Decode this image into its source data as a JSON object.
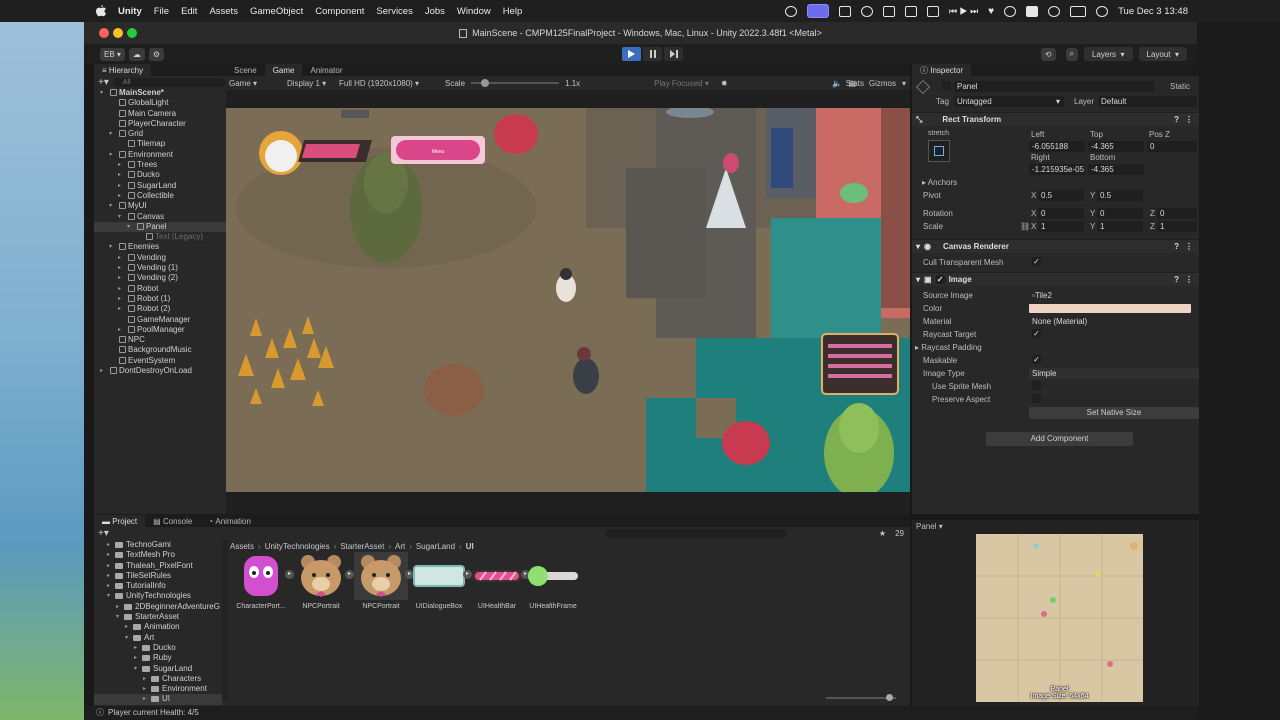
{
  "menubar": {
    "app": "Unity",
    "items": [
      "File",
      "Edit",
      "Assets",
      "GameObject",
      "Component",
      "Services",
      "Jobs",
      "Window",
      "Help"
    ],
    "clock": "Tue Dec 3  13:48"
  },
  "window": {
    "title": "MainScene - CMPM125FinalProject - Windows, Mac, Linux - Unity 2022.3.48f1 <Metal>"
  },
  "toolbar": {
    "account": "EB",
    "layers": "Layers",
    "layout": "Layout"
  },
  "hierarchy": {
    "tab": "Hierarchy",
    "search_placeholder": "All",
    "rows": [
      {
        "label": "MainScene*",
        "depth": 0,
        "arrow": "▾",
        "bold": true
      },
      {
        "label": "GlobalLight",
        "depth": 1
      },
      {
        "label": "Main Camera",
        "depth": 1
      },
      {
        "label": "PlayerCharacter",
        "depth": 1
      },
      {
        "label": "Grid",
        "depth": 1,
        "arrow": "▾"
      },
      {
        "label": "Tilemap",
        "depth": 2
      },
      {
        "label": "Environment",
        "depth": 1,
        "arrow": "▾"
      },
      {
        "label": "Trees",
        "depth": 2,
        "arrow": "▸"
      },
      {
        "label": "Ducko",
        "depth": 2,
        "arrow": "▸"
      },
      {
        "label": "SugarLand",
        "depth": 2,
        "arrow": "▸"
      },
      {
        "label": "Collectible",
        "depth": 2,
        "arrow": "▸"
      },
      {
        "label": "MyUI",
        "depth": 1,
        "arrow": "▾"
      },
      {
        "label": "Canvas",
        "depth": 2,
        "arrow": "▾"
      },
      {
        "label": "Panel",
        "depth": 3,
        "arrow": "▾",
        "sel": true
      },
      {
        "label": "Text (Legacy)",
        "depth": 4,
        "dim": true
      },
      {
        "label": "Enemies",
        "depth": 1,
        "arrow": "▾"
      },
      {
        "label": "Vending",
        "depth": 2,
        "arrow": "▸"
      },
      {
        "label": "Vending (1)",
        "depth": 2,
        "arrow": "▸"
      },
      {
        "label": "Vending (2)",
        "depth": 2,
        "arrow": "▸"
      },
      {
        "label": "Robot",
        "depth": 2,
        "arrow": "▸"
      },
      {
        "label": "Robot (1)",
        "depth": 2,
        "arrow": "▸"
      },
      {
        "label": "Robot (2)",
        "depth": 2,
        "arrow": "▸"
      },
      {
        "label": "GameManager",
        "depth": 2
      },
      {
        "label": "PoolManager",
        "depth": 2,
        "arrow": "▸"
      },
      {
        "label": "NPC",
        "depth": 1
      },
      {
        "label": "BackgroundMusic",
        "depth": 1
      },
      {
        "label": "EventSystem",
        "depth": 1
      },
      {
        "label": "DontDestroyOnLoad",
        "depth": 0,
        "arrow": "▸"
      }
    ]
  },
  "scene": {
    "tabs": [
      "Scene",
      "Game",
      "Animator"
    ],
    "game": "Game",
    "display": "Display 1",
    "resolution": "Full HD (1920x1080)",
    "scale_label": "Scale",
    "scale_value": "1.1x",
    "play_focused": "Play Focused",
    "stats": "Stats",
    "gizmos": "Gizmos",
    "ui_button_text": "Menu"
  },
  "inspector": {
    "tab": "Inspector",
    "name": "Panel",
    "static": "Static",
    "tag_label": "Tag",
    "tag": "Untagged",
    "layer_label": "Layer",
    "layer": "Default",
    "rect_transform": "Rect Transform",
    "stretch": "stretch",
    "left_label": "Left",
    "left": "-6.055188",
    "top_label": "Top",
    "top": "-4.365",
    "posz_label": "Pos Z",
    "posz": "0",
    "right_label": "Right",
    "right": "-1.215935e-05",
    "bottom_label": "Bottom",
    "bottom": "-4.365",
    "anchors": "Anchors",
    "pivot": "Pivot",
    "pivot_x": "0.5",
    "pivot_y": "0.5",
    "rotation": "Rotation",
    "rot": [
      "0",
      "0",
      "0"
    ],
    "scale": "Scale",
    "scl": [
      "1",
      "1",
      "1"
    ],
    "canvas_renderer": "Canvas Renderer",
    "cull": "Cull Transparent Mesh",
    "image": "Image",
    "source_image": "Source Image",
    "source_value": "Tile2",
    "color": "Color",
    "material": "Material",
    "material_value": "None (Material)",
    "raycast_target": "Raycast Target",
    "raycast_padding": "Raycast Padding",
    "maskable": "Maskable",
    "image_type": "Image Type",
    "image_type_value": "Simple",
    "use_sprite_mesh": "Use Sprite Mesh",
    "preserve_aspect": "Preserve Aspect",
    "set_native": "Set Native Size",
    "add_component": "Add Component",
    "preview_label": "Panel",
    "preview_caption1": "Panel",
    "preview_caption2": "Image Size: 64x64"
  },
  "project": {
    "tabs": [
      "Project",
      "Console",
      "Animation"
    ],
    "breadcrumb": [
      "Assets",
      "UnityTechnologies",
      "StarterAsset",
      "Art",
      "SugarLand",
      "UI"
    ],
    "count": "29",
    "tree": [
      {
        "label": "TechnoGami",
        "d": 1
      },
      {
        "label": "TextMesh Pro",
        "d": 1
      },
      {
        "label": "Thaleah_PixelFont",
        "d": 1
      },
      {
        "label": "TileSetRules",
        "d": 1
      },
      {
        "label": "TutorialInfo",
        "d": 1
      },
      {
        "label": "UnityTechnologies",
        "d": 1,
        "arrow": "▾"
      },
      {
        "label": "2DBeginnerAdventureG",
        "d": 2
      },
      {
        "label": "StarterAsset",
        "d": 2,
        "arrow": "▾"
      },
      {
        "label": "Animation",
        "d": 3
      },
      {
        "label": "Art",
        "d": 3,
        "arrow": "▾"
      },
      {
        "label": "Ducko",
        "d": 4
      },
      {
        "label": "Ruby",
        "d": 4
      },
      {
        "label": "SugarLand",
        "d": 4,
        "arrow": "▾"
      },
      {
        "label": "Characters",
        "d": 5
      },
      {
        "label": "Environment",
        "d": 5
      },
      {
        "label": "UI",
        "d": 5
      }
    ],
    "assets": [
      {
        "label": "CharacterPort...",
        "kind": "pink"
      },
      {
        "label": "NPCPortrait",
        "kind": "bear"
      },
      {
        "label": "NPCPortrait",
        "kind": "bear2"
      },
      {
        "label": "UIDialogueBox",
        "kind": "box"
      },
      {
        "label": "UIHealthBar",
        "kind": "bar"
      },
      {
        "label": "UIHealthFrame",
        "kind": "frame"
      }
    ]
  },
  "status": {
    "text": "Player current Health: 4/5"
  }
}
